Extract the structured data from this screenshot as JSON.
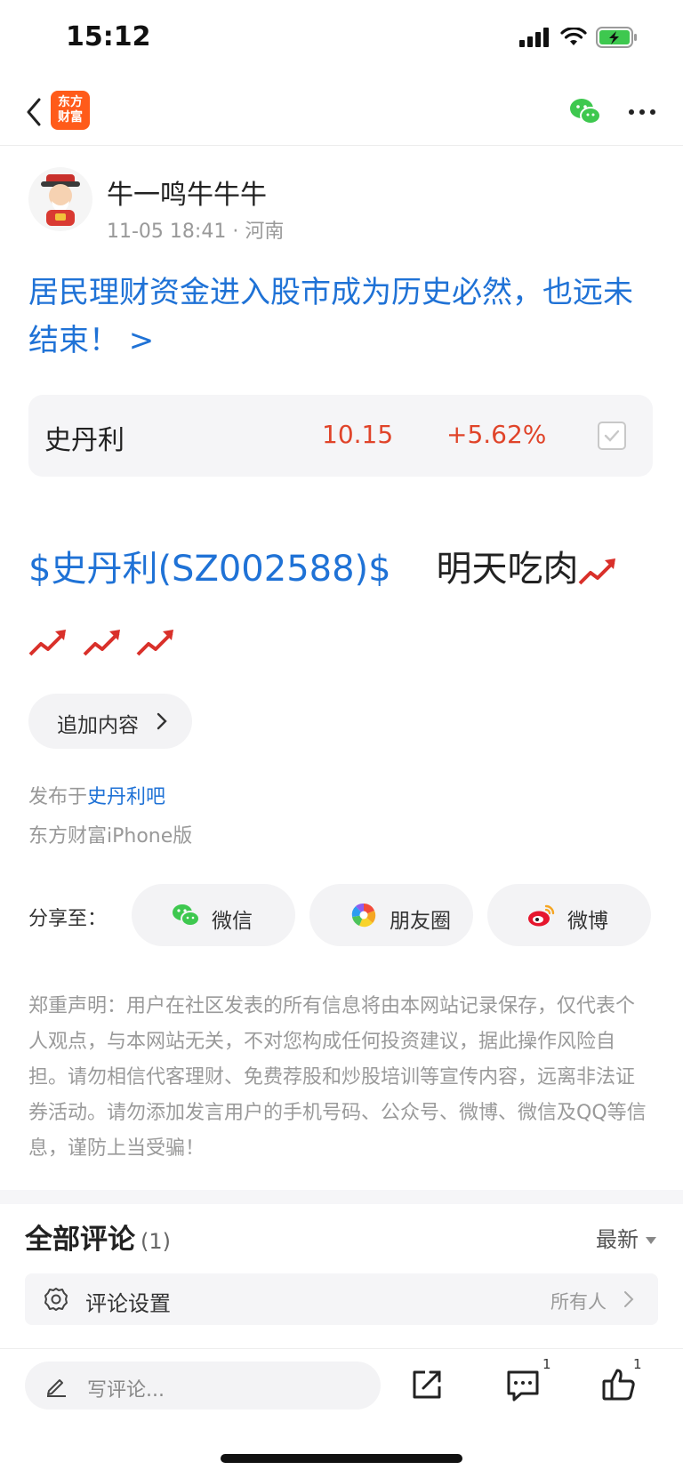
{
  "status_bar": {
    "time": "15:12"
  },
  "nav": {
    "logo_line1": "东方",
    "logo_line2": "财富"
  },
  "author": {
    "name": "牛一鸣牛牛牛",
    "datetime": "11-05 18:41",
    "location": "河南"
  },
  "post": {
    "title": "居民理财资金进入股市成为历史必然，也远未结束！ >",
    "stock_tag": "$史丹利(SZ002588)$",
    "body_text": "明天吃肉"
  },
  "stock_card": {
    "name": "史丹利",
    "price": "10.15",
    "change": "+5.62%",
    "change_color": "#e0442a"
  },
  "append_button": {
    "label": "追加内容"
  },
  "publish": {
    "prefix": "发布于",
    "bar_name": "史丹利吧",
    "client": "东方财富iPhone版"
  },
  "share": {
    "label": "分享至：",
    "targets": [
      {
        "label": "微信",
        "icon": "wechat-icon"
      },
      {
        "label": "朋友圈",
        "icon": "moments-icon"
      },
      {
        "label": "微博",
        "icon": "weibo-icon"
      }
    ]
  },
  "disclaimer": "郑重声明：用户在社区发表的所有信息将由本网站记录保存，仅代表个人观点，与本网站无关，不对您构成任何投资建议，据此操作风险自担。请勿相信代客理财、免费荐股和炒股培训等宣传内容，远离非法证券活动。请勿添加发言用户的手机号码、公众号、微博、微信及QQ等信息，谨防上当受骗！",
  "comments": {
    "title": "全部评论",
    "count": "(1)",
    "sort_label": "最新",
    "settings_label": "评论设置",
    "settings_value": "所有人"
  },
  "bottom_bar": {
    "placeholder": "写评论...",
    "comment_count": "1",
    "like_count": "1"
  },
  "colors": {
    "accent_blue": "#1f72d6",
    "rise_red": "#e0442a",
    "brand_orange": "#ff5b1a"
  }
}
